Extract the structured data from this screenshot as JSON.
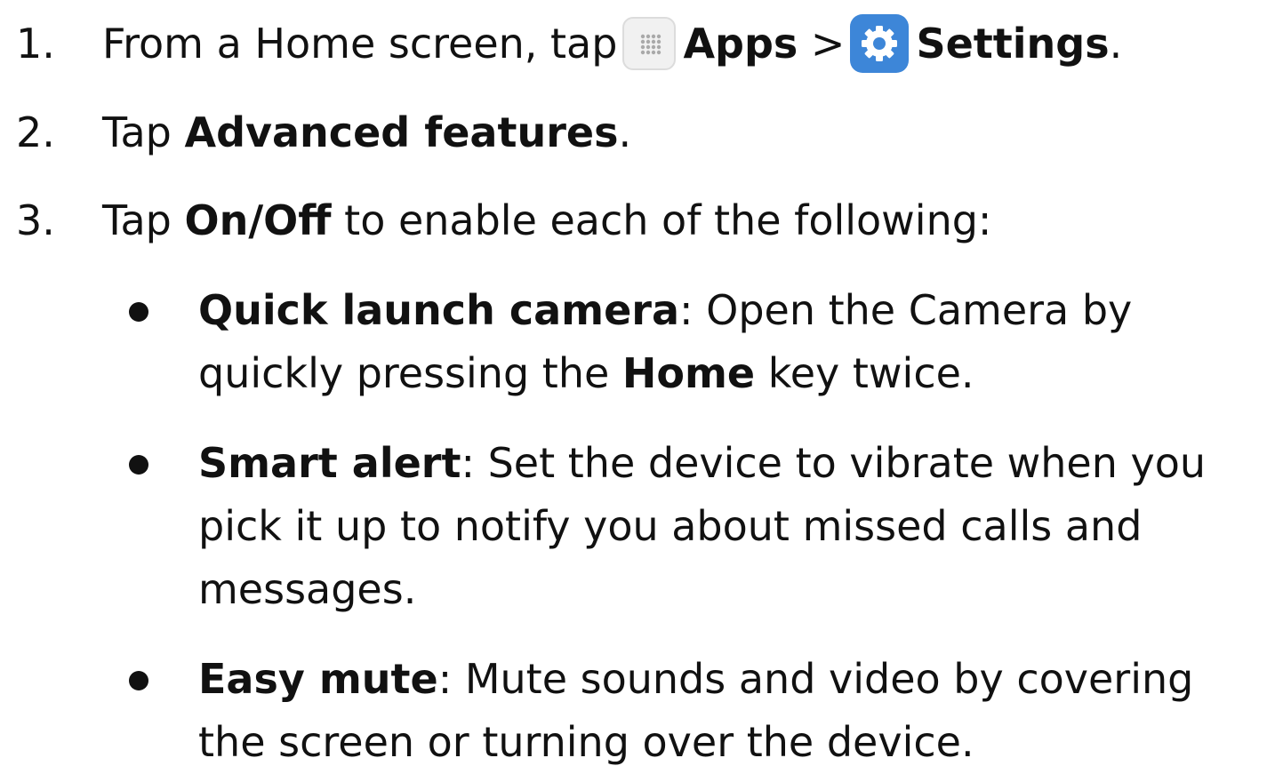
{
  "steps": [
    {
      "number": "1.",
      "prefix": "From a Home screen, tap",
      "apps_label": "Apps",
      "separator": ">",
      "settings_label": "Settings",
      "suffix": "."
    },
    {
      "number": "2.",
      "prefix": "Tap ",
      "bold": "Advanced features",
      "suffix": "."
    },
    {
      "number": "3.",
      "prefix": "Tap ",
      "bold": "On/Off",
      "suffix": " to enable each of the following:"
    }
  ],
  "features": [
    {
      "title": "Quick launch camera",
      "text_before": ": Open the Camera by quickly pressing the ",
      "bold_inline": "Home",
      "text_after": " key twice."
    },
    {
      "title": "Smart alert",
      "text": ": Set the device to vibrate when you pick it up to notify you about missed calls and messages."
    },
    {
      "title": "Easy mute",
      "text": ": Mute sounds and video by covering the screen or turning over the device."
    }
  ],
  "icons": {
    "apps": "apps-grid-icon",
    "settings": "settings-gear-icon",
    "settings_color": "#3d86d8"
  }
}
